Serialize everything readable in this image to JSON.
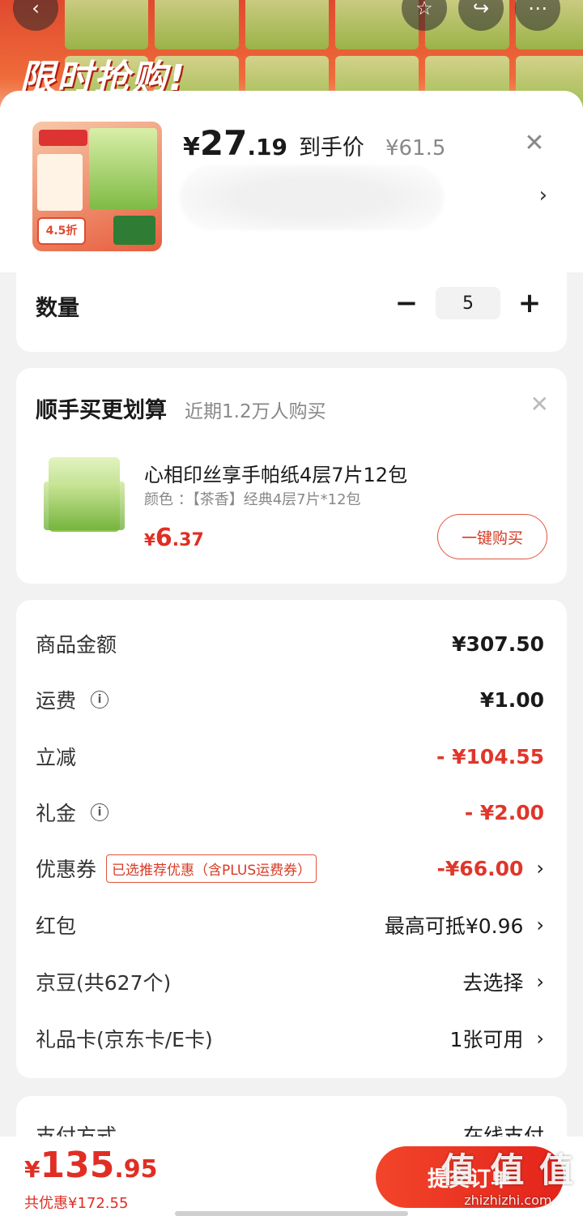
{
  "background": {
    "banner_text": "限时抢购!",
    "icons": [
      "back-icon",
      "star-icon",
      "share-icon",
      "more-icon"
    ]
  },
  "product": {
    "currency": "¥",
    "price_int": "27",
    "price_dec": ".19",
    "price_label": "到手价",
    "original_price": "¥61.5",
    "thumb_badge": "4.5折"
  },
  "quantity": {
    "label": "数量",
    "value": "5",
    "minus": "−",
    "plus": "+"
  },
  "addon": {
    "title": "顺手买更划算",
    "subtitle": "近期1.2万人购买",
    "name": "心相印丝享手帕纸4层7片12包",
    "spec": "颜色 ：【茶香】经典4层7片*12包",
    "price_currency": "¥",
    "price_int": "6",
    "price_dec": ".37",
    "buy_label": "一键购买"
  },
  "summary": {
    "goods_label": "商品金额",
    "goods_value": "¥307.50",
    "shipping_label": "运费",
    "shipping_value": "¥1.00",
    "discount_label": "立减",
    "discount_value": "- ¥104.55",
    "gift_label": "礼金",
    "gift_value": "- ¥2.00",
    "coupon_label": "优惠券",
    "coupon_tag": "已选推荐优惠（含PLUS运费券）",
    "coupon_value": "-¥66.00",
    "redpacket_label": "红包",
    "redpacket_value": "最高可抵¥0.96",
    "beans_label": "京豆(共627个)",
    "beans_value": "去选择",
    "giftcard_label": "礼品卡(京东卡/E卡)",
    "giftcard_value": "1张可用"
  },
  "payment": {
    "label": "支付方式",
    "value": "在线支付"
  },
  "bottom": {
    "currency": "¥",
    "total_int": "135",
    "total_dec": ".95",
    "saved": "共优惠¥172.55",
    "submit_label": "提交订单",
    "watermark_logo": "值 值 值",
    "watermark_text": "zhizhizhi.com"
  },
  "colors": {
    "accent": "#e02e24",
    "button": "#e4231b"
  }
}
